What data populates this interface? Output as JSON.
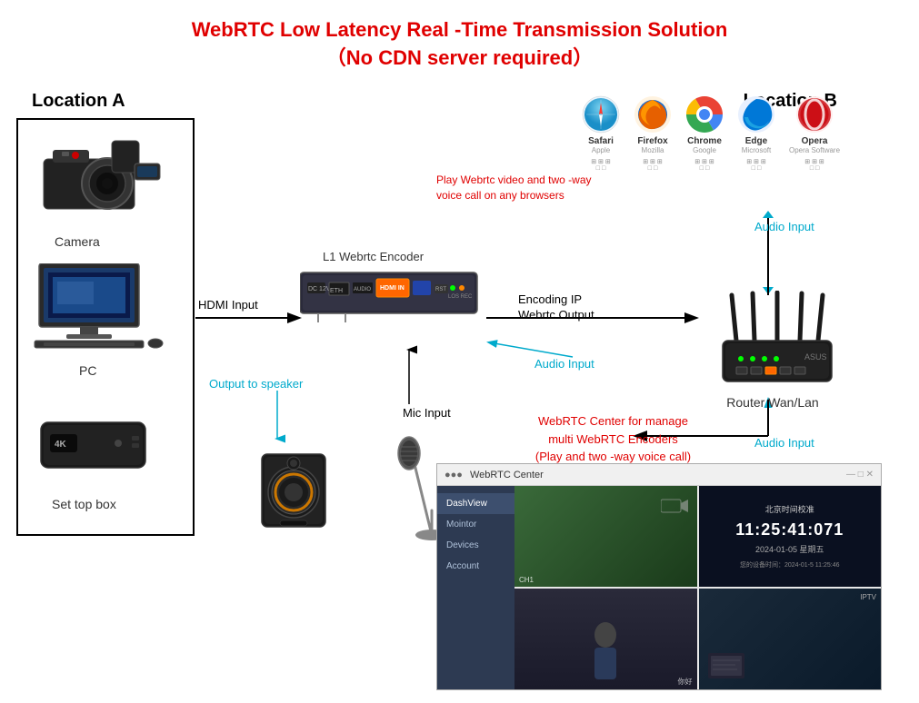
{
  "title": {
    "line1": "WebRTC Low Latency Real -Time Transmission Solution",
    "line2": "（No CDN server required）"
  },
  "location_a": {
    "label": "Location A",
    "box": true,
    "devices": [
      {
        "name": "Camera",
        "label": "Camera"
      },
      {
        "name": "PC",
        "label": "PC"
      },
      {
        "name": "Set top box",
        "label": "Set top box"
      }
    ]
  },
  "location_b": {
    "label": "Location B",
    "browsers": [
      {
        "name": "Safari",
        "sub": "Apple",
        "color": "#0fb5f5"
      },
      {
        "name": "Firefox",
        "sub": "Mozilla",
        "color": "#e66000"
      },
      {
        "name": "Chrome",
        "sub": "Google",
        "color": "#4285f4"
      },
      {
        "name": "Edge",
        "sub": "Microsoft",
        "color": "#0078d7"
      },
      {
        "name": "Opera",
        "sub": "Opera Software",
        "color": "#cc0f16"
      }
    ]
  },
  "labels": {
    "play_webrtc": "Play Webrtc video and two -way voice call on any browsers",
    "hdmi_input": "HDMI Input",
    "encoder_label": "L1 Webrtc Encoder",
    "encoding_ip": "Encoding IP\nWebrtc Output",
    "audio_input_top": "Audio Input",
    "audio_input_mid": "Audio Input",
    "audio_input_bot": "Audio Input",
    "output_to_speaker": "Output to speaker",
    "mic_input": "Mic Input",
    "webrtc_center": "WebRTC Center for manage\nmulti WebRTC Encoders\n(Play and two -way voice call)",
    "router_label": "Router Wan/Lan"
  },
  "webrtc_center_ui": {
    "title": "WebRTC Center",
    "sidebar_items": [
      "DashView",
      "Mointor",
      "Devices",
      "Account"
    ],
    "clock": {
      "time": "11:25:41:071",
      "date": "2024-01-05 星期五",
      "label": "北京时间校准",
      "sub": "您的设备时间：2024-01-5 11:25:46"
    }
  }
}
